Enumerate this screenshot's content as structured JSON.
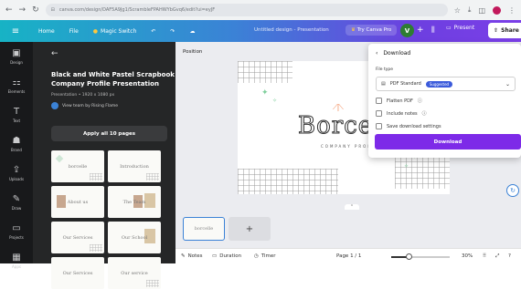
{
  "browser": {
    "url": "canva.com/design/DAF5A9Jg1/ScrambleFPAHWYbGvq6/edit?ui=eyJF",
    "back_icon": "arrow-left",
    "forward_icon": "arrow-right",
    "reload_icon": "reload"
  },
  "topbar": {
    "home": "Home",
    "file": "File",
    "magic_switch": "Magic Switch",
    "doc_title": "Untitled design - Presentation",
    "try_pro": "Try Canva Pro",
    "avatar_letter": "V",
    "present": "Present",
    "share": "Share"
  },
  "rail": {
    "items": [
      {
        "icon": "▣",
        "label": "Design"
      },
      {
        "icon": "⚏",
        "label": "Elements"
      },
      {
        "icon": "T",
        "label": "Text"
      },
      {
        "icon": "☗",
        "label": "Brand"
      },
      {
        "icon": "⇪",
        "label": "Uploads"
      },
      {
        "icon": "✎",
        "label": "Draw"
      },
      {
        "icon": "▭",
        "label": "Projects"
      },
      {
        "icon": "▦",
        "label": "Apps"
      }
    ]
  },
  "panel": {
    "title": "Black and White Pastel Scrapbook Company Profile Presentation",
    "meta": "Presentation • 1920 x 1080 px",
    "team": "View team by Rising Flame",
    "apply_button": "Apply all 10 pages",
    "thumbnails": [
      {
        "label": "borcelle"
      },
      {
        "label": "Introduction"
      },
      {
        "label": "About us"
      },
      {
        "label": "The Team"
      },
      {
        "label": "Our Services"
      },
      {
        "label": "Our School"
      },
      {
        "label": "Our Services"
      },
      {
        "label": "Our service"
      }
    ]
  },
  "editor": {
    "position_label": "Position",
    "canvas_title": "Borce",
    "canvas_subtitle": "COMPANY PROF",
    "page_thumb_label": "borcelle",
    "add_page": "+"
  },
  "bottombar": {
    "notes": "Notes",
    "duration": "Duration",
    "timer": "Timer",
    "page": "Page 1 / 1",
    "zoom": "30%",
    "zoom_fraction": 0.3
  },
  "download": {
    "title": "Download",
    "file_type_label": "File type",
    "file_type_value": "PDF Standard",
    "badge": "Suggested",
    "options": [
      {
        "label": "Flatten PDF",
        "checked": false
      },
      {
        "label": "Include notes",
        "checked": false
      },
      {
        "label": "Save download settings",
        "checked": false
      }
    ],
    "button": "Download"
  }
}
